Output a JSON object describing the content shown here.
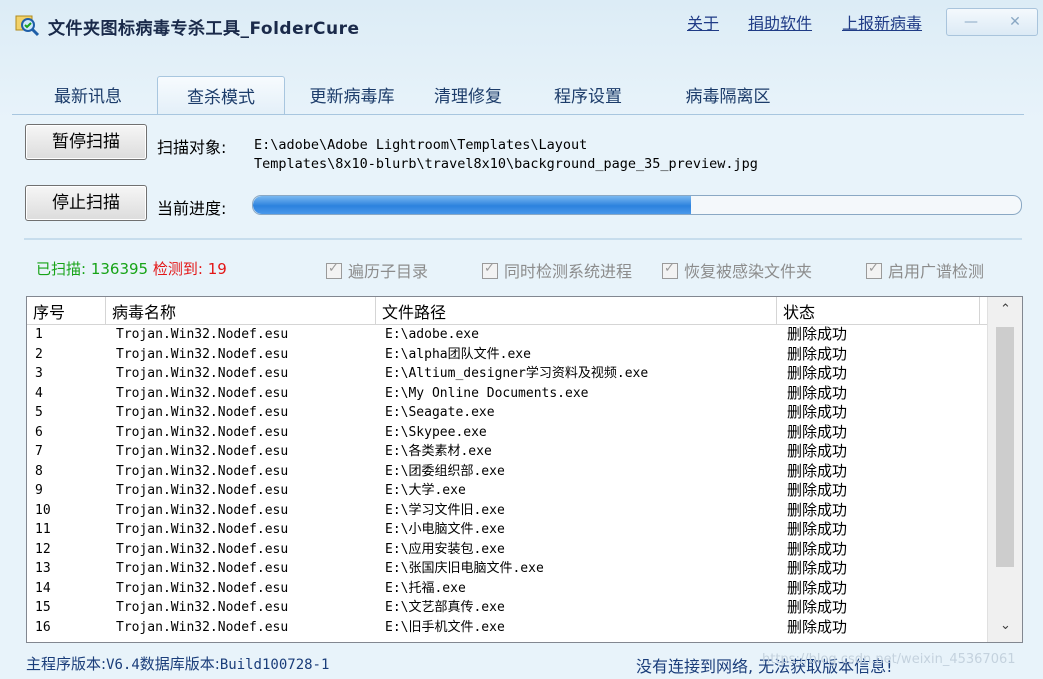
{
  "window": {
    "title": "文件夹图标病毒专杀工具_FolderCure",
    "links": [
      "关于",
      "捐助软件",
      "上报新病毒"
    ],
    "minimize_icon": "minimize-icon",
    "close_icon": "close-icon"
  },
  "tabs": [
    "最新讯息",
    "查杀模式",
    "更新病毒库",
    "清理修复",
    "程序设置",
    "病毒隔离区"
  ],
  "active_tab": "查杀模式",
  "scan": {
    "pause_label": "暂停扫描",
    "stop_label": "停止扫描",
    "target_label": "扫描对象:",
    "target_line1": "E:\\adobe\\Adobe Lightroom\\Templates\\Layout",
    "target_line2": "Templates\\8x10-blurb\\travel8x10\\background_page_35_preview.jpg",
    "progress_label": "当前进度:",
    "progress_fraction": 0.57
  },
  "counts": {
    "scanned_label": "已扫描:",
    "scanned_value": "136395",
    "detected_label": "检测到:",
    "detected_value": "19"
  },
  "options": [
    {
      "label": "遍历子目录",
      "checked": true
    },
    {
      "label": "同时检测系统进程",
      "checked": true
    },
    {
      "label": "恢复被感染文件夹",
      "checked": true
    },
    {
      "label": "启用广谱检测",
      "checked": true
    }
  ],
  "table": {
    "columns": [
      "序号",
      "病毒名称",
      "文件路径",
      "状态"
    ],
    "rows": [
      [
        "1",
        "Trojan.Win32.Nodef.esu",
        "E:\\adobe.exe",
        "删除成功"
      ],
      [
        "2",
        "Trojan.Win32.Nodef.esu",
        "E:\\alpha团队文件.exe",
        "删除成功"
      ],
      [
        "3",
        "Trojan.Win32.Nodef.esu",
        "E:\\Altium_designer学习资料及视频.exe",
        "删除成功"
      ],
      [
        "4",
        "Trojan.Win32.Nodef.esu",
        "E:\\My Online Documents.exe",
        "删除成功"
      ],
      [
        "5",
        "Trojan.Win32.Nodef.esu",
        "E:\\Seagate.exe",
        "删除成功"
      ],
      [
        "6",
        "Trojan.Win32.Nodef.esu",
        "E:\\Skypee.exe",
        "删除成功"
      ],
      [
        "7",
        "Trojan.Win32.Nodef.esu",
        "E:\\各类素材.exe",
        "删除成功"
      ],
      [
        "8",
        "Trojan.Win32.Nodef.esu",
        "E:\\团委组织部.exe",
        "删除成功"
      ],
      [
        "9",
        "Trojan.Win32.Nodef.esu",
        "E:\\大学.exe",
        "删除成功"
      ],
      [
        "10",
        "Trojan.Win32.Nodef.esu",
        "E:\\学习文件旧.exe",
        "删除成功"
      ],
      [
        "11",
        "Trojan.Win32.Nodef.esu",
        "E:\\小电脑文件.exe",
        "删除成功"
      ],
      [
        "12",
        "Trojan.Win32.Nodef.esu",
        "E:\\应用安装包.exe",
        "删除成功"
      ],
      [
        "13",
        "Trojan.Win32.Nodef.esu",
        "E:\\张国庆旧电脑文件.exe",
        "删除成功"
      ],
      [
        "14",
        "Trojan.Win32.Nodef.esu",
        "E:\\托福.exe",
        "删除成功"
      ],
      [
        "15",
        "Trojan.Win32.Nodef.esu",
        "E:\\文艺部真传.exe",
        "删除成功"
      ],
      [
        "16",
        "Trojan.Win32.Nodef.esu",
        "E:\\旧手机文件.exe",
        "删除成功"
      ]
    ]
  },
  "status": {
    "main_version_label": "主程序版本:",
    "main_version": "V6.4",
    "db_version_label": "数据库版本:",
    "db_version": "Build100728-1",
    "network_message": "没有连接到网络, 无法获取版本信息!",
    "watermark": "https://blog.csdn.net/weixin_45367061"
  }
}
